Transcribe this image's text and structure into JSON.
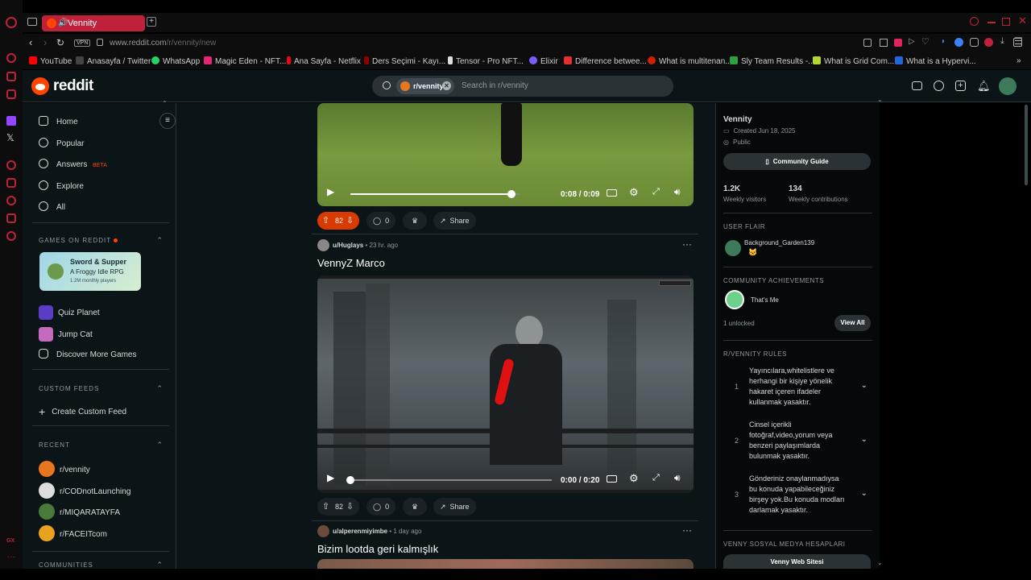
{
  "browser": {
    "tab_title": "Vennity",
    "url_prefix": "www.reddit.com",
    "url_path": "/r/vennity/new",
    "vpn": "VPN",
    "bookmarks": [
      {
        "label": "YouTube",
        "color": "#ff0000"
      },
      {
        "label": "Anasayfa / Twitter",
        "color": "#ffffff"
      },
      {
        "label": "WhatsApp",
        "color": "#25d366"
      },
      {
        "label": "Magic Eden - NFT...",
        "color": "#e42575"
      },
      {
        "label": "Ana Sayfa - Netflix",
        "color": "#e50914"
      },
      {
        "label": "Ders Seçimi - Kayı...",
        "color": "#8b0000"
      },
      {
        "label": "Tensor - Pro NFT...",
        "color": "#dddddd"
      },
      {
        "label": "Elixir",
        "color": "#7b5cff"
      },
      {
        "label": "Difference betwee...",
        "color": "#e03030"
      },
      {
        "label": "What is multitenan...",
        "color": "#cc2200"
      },
      {
        "label": "Sly Team Results -...",
        "color": "#2ea043"
      },
      {
        "label": "What is Grid Com...",
        "color": "#b6d632"
      },
      {
        "label": "What is a Hypervi...",
        "color": "#2266dd"
      }
    ]
  },
  "header": {
    "logo": "reddit",
    "search_chip": "r/vennity",
    "search_placeholder": "Search in r/vennity"
  },
  "sidebar": {
    "nav": [
      {
        "label": "Home",
        "icon": "home-icon"
      },
      {
        "label": "Popular",
        "icon": "popular-icon"
      },
      {
        "label": "Answers",
        "icon": "answers-icon",
        "badge": "BETA"
      },
      {
        "label": "Explore",
        "icon": "explore-icon"
      },
      {
        "label": "All",
        "icon": "all-icon"
      }
    ],
    "games_head": "GAMES ON REDDIT",
    "featured_game": {
      "title": "Sword & Supper",
      "subtitle": "A Froggy Idle RPG",
      "players": "1.2M monthly players"
    },
    "games": [
      {
        "label": "Quiz Planet"
      },
      {
        "label": "Jump Cat"
      },
      {
        "label": "Discover More Games"
      }
    ],
    "custom_feeds_head": "CUSTOM FEEDS",
    "create_custom_feed": "Create Custom Feed",
    "recent_head": "RECENT",
    "recent": [
      {
        "label": "r/vennity",
        "color": "#e8761e"
      },
      {
        "label": "r/CODnotLaunching",
        "color": "#dddddd"
      },
      {
        "label": "r/MIQARATAYFA",
        "color": "#4a7a3a"
      },
      {
        "label": "r/FACEITcom",
        "color": "#e8a21e"
      }
    ],
    "communities_head": "COMMUNITIES"
  },
  "feed": {
    "post1": {
      "time_current": "0:08",
      "time_total": "0:09",
      "progress": 0.95,
      "votes": "82",
      "comments": "0",
      "share": "Share"
    },
    "post2": {
      "user": "u/Huglays",
      "sep": "•",
      "age": "23 hr. ago",
      "title": "VennyZ Marco",
      "time_current": "0:00",
      "time_total": "0:20",
      "progress": 0.0,
      "votes": "82",
      "comments": "0",
      "share": "Share"
    },
    "post3": {
      "user": "u/alperenmiyimbe",
      "sep": "•",
      "age": "1 day ago",
      "title": "Bizim lootda geri kalmışlık"
    }
  },
  "rail": {
    "name": "Vennity",
    "created": "Created Jun 18, 2025",
    "visibility": "Public",
    "guide_button": "Community Guide",
    "visitors_value": "1.2K",
    "visitors_label": "Weekly visitors",
    "contrib_value": "134",
    "contrib_label": "Weekly contributions",
    "user_flair_head": "USER FLAIR",
    "flair_user": "Background_Garden139",
    "achievements_head": "COMMUNITY ACHIEVEMENTS",
    "achievement": "That's Me",
    "unlocked": "1 unlocked",
    "view_all": "View All",
    "rules_head": "R/VENNITY RULES",
    "rules": [
      {
        "num": "1",
        "text": "Yayıncılara,whitelistlere ve herhangi bir kişiye yönelik hakaret içeren ifadeler kullanmak yasaktır."
      },
      {
        "num": "2",
        "text": "Cinsel içerikli fotoğraf,video,yorum veya benzeri paylaşımlarda bulunmak yasaktır."
      },
      {
        "num": "3",
        "text": "Gönderiniz onaylanmadıysa bu konuda yapabileceğiniz birşey yok.Bu konuda modları darlamak yasaktır."
      }
    ],
    "social_head": "VENNY SOSYAL MEDYA HESAPLARI",
    "web_button": "Venny Web Sitesi"
  },
  "colors": {
    "accent": "#ff4500",
    "opera": "#c0213a"
  }
}
